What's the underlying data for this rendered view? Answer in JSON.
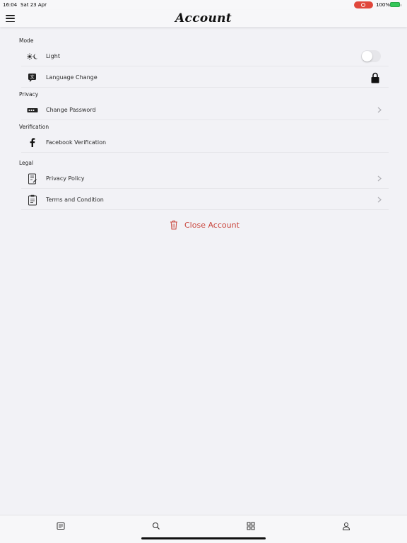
{
  "status_bar": {
    "time": "16:04",
    "date": "Sat 23 Apr",
    "battery": "100%",
    "recording_color": "#e0473c",
    "battery_color": "#34c759"
  },
  "header": {
    "title": "Account",
    "menu_icon": "hamburger-menu-icon"
  },
  "sections": {
    "mode": {
      "label": "Mode",
      "items": [
        {
          "label": "Light",
          "icon": "sun-moon-icon",
          "control": "toggle",
          "toggle_on": false
        },
        {
          "label": "Language Change",
          "icon": "language-icon",
          "control": "lock-icon"
        }
      ]
    },
    "privacy": {
      "label": "Privacy",
      "items": [
        {
          "label": "Change Password",
          "icon": "password-icon",
          "control": "chevron-right-icon"
        }
      ]
    },
    "verification": {
      "label": "Verification",
      "items": [
        {
          "label": "Facebook Verification",
          "icon": "facebook-icon"
        }
      ]
    },
    "legal": {
      "label": "Legal",
      "items": [
        {
          "label": "Privacy Policy",
          "icon": "policy-document-icon",
          "control": "chevron-right-icon"
        },
        {
          "label": "Terms and Condition",
          "icon": "clipboard-icon",
          "control": "chevron-right-icon"
        }
      ]
    }
  },
  "close_account": {
    "label": "Close Account",
    "icon": "trash-icon",
    "color": "#c9463d"
  },
  "tab_bar": {
    "tabs": [
      {
        "icon": "news-icon"
      },
      {
        "icon": "search-icon"
      },
      {
        "icon": "grid-icon"
      },
      {
        "icon": "profile-icon"
      }
    ]
  }
}
